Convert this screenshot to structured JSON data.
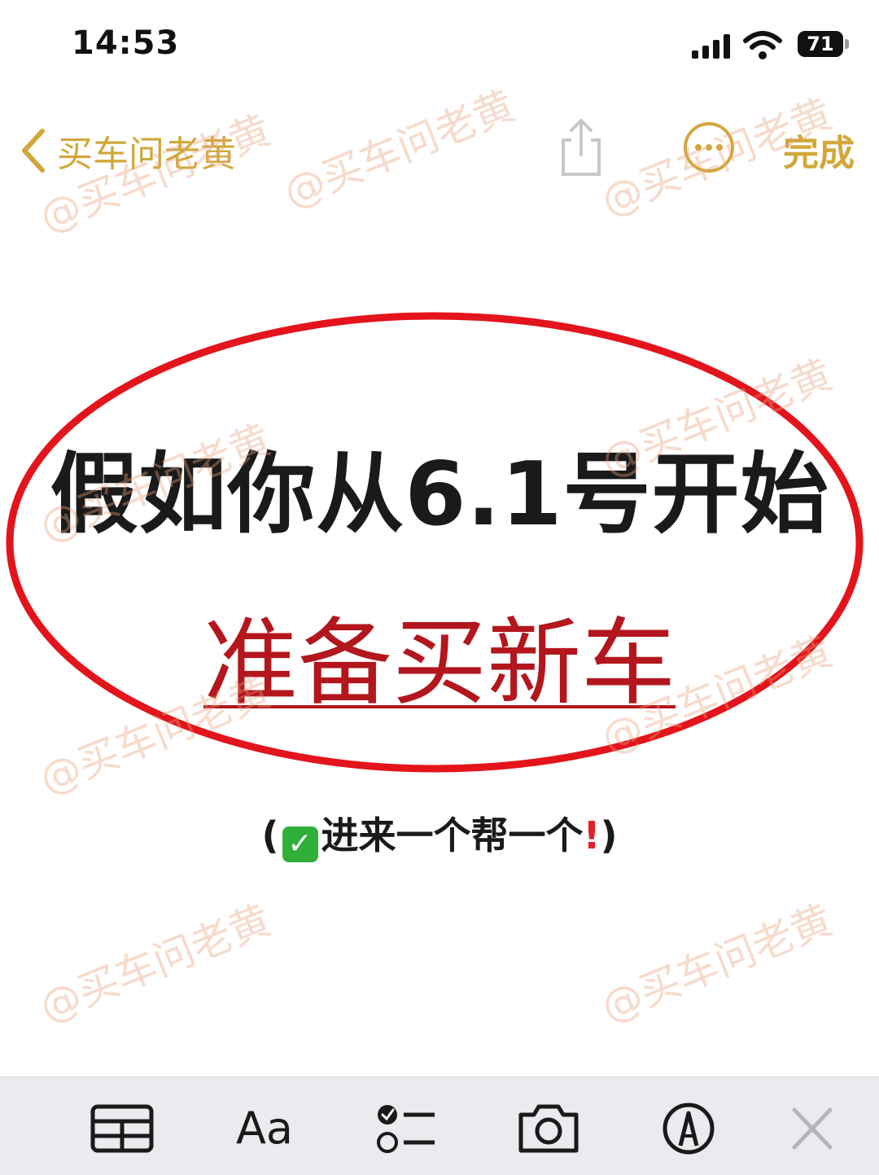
{
  "status_bar": {
    "time": "14:53",
    "battery": "71"
  },
  "nav": {
    "back_label": "买车问老黄",
    "done_label": "完成",
    "accent_color": "#d2a73a"
  },
  "content": {
    "headline": "假如你从6.1号开始",
    "subheadline": "准备买新车",
    "tagline_open": "(",
    "tagline_text": "进来一个帮一个",
    "tagline_close": ")",
    "ellipse_color": "#e3141b",
    "subheadline_color": "#b3161c"
  },
  "watermark": "@买车问老黄",
  "toolbar": {
    "format_label": "Aa"
  },
  "icons": [
    "chevron-left-icon",
    "share-icon",
    "more-icon",
    "table-icon",
    "checklist-icon",
    "camera-icon",
    "markup-icon",
    "close-icon",
    "signal-icon",
    "wifi-icon",
    "battery-icon"
  ]
}
